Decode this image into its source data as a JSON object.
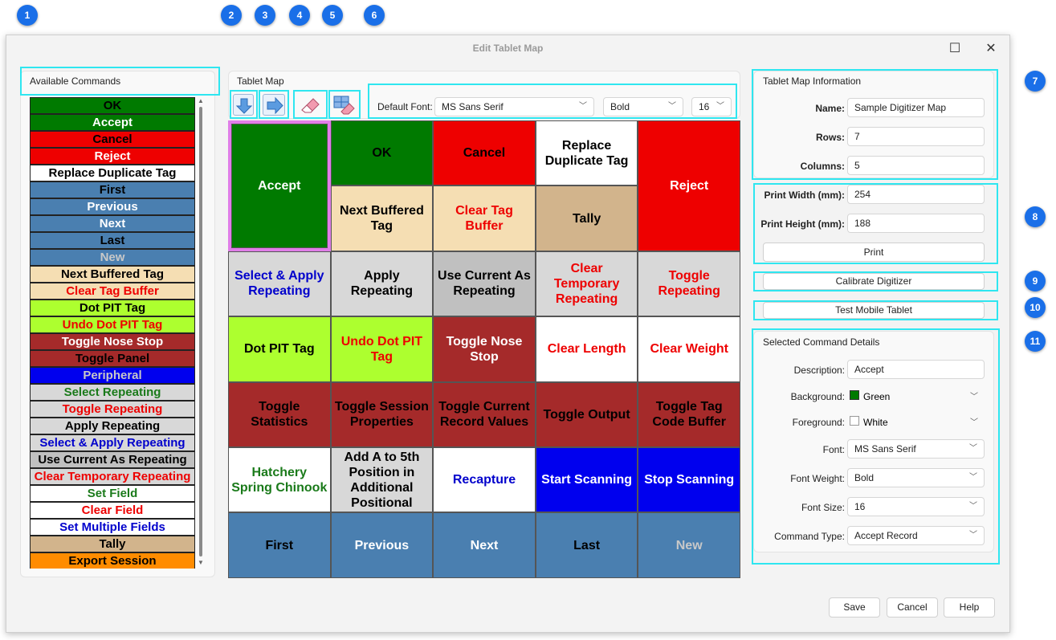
{
  "window": {
    "title": "Edit Tablet Map",
    "maximize_glyph": "☐",
    "close_glyph": "✕"
  },
  "callouts": [
    "1",
    "2",
    "3",
    "4",
    "5",
    "6",
    "7",
    "8",
    "9",
    "10",
    "11"
  ],
  "available": {
    "caption": "Available Commands",
    "items": [
      {
        "label": "OK",
        "bg": "#007a00",
        "fg": "#000000"
      },
      {
        "label": "Accept",
        "bg": "#007a00",
        "fg": "#ffffff"
      },
      {
        "label": "Cancel",
        "bg": "#ee0000",
        "fg": "#000000"
      },
      {
        "label": "Reject",
        "bg": "#ee0000",
        "fg": "#ffffff"
      },
      {
        "label": "Replace Duplicate Tag",
        "bg": "#ffffff",
        "fg": "#000000"
      },
      {
        "label": "First",
        "bg": "#4a7fb0",
        "fg": "#000000"
      },
      {
        "label": "Previous",
        "bg": "#4a7fb0",
        "fg": "#ffffff"
      },
      {
        "label": "Next",
        "bg": "#4a7fb0",
        "fg": "#ffffff"
      },
      {
        "label": "Last",
        "bg": "#4a7fb0",
        "fg": "#000000"
      },
      {
        "label": "New",
        "bg": "#4a7fb0",
        "fg": "#c8c8c8"
      },
      {
        "label": "Next Buffered Tag",
        "bg": "#f5deb3",
        "fg": "#000000"
      },
      {
        "label": "Clear Tag Buffer",
        "bg": "#f5deb3",
        "fg": "#ee0000"
      },
      {
        "label": "Dot PIT Tag",
        "bg": "#adff2f",
        "fg": "#000000"
      },
      {
        "label": "Undo Dot PIT Tag",
        "bg": "#adff2f",
        "fg": "#ee0000"
      },
      {
        "label": "Toggle Nose Stop",
        "bg": "#a52a2a",
        "fg": "#ffffff"
      },
      {
        "label": "Toggle Panel",
        "bg": "#a52a2a",
        "fg": "#000000"
      },
      {
        "label": "Peripheral",
        "bg": "#0000ee",
        "fg": "#c8c8c8"
      },
      {
        "label": "Select Repeating",
        "bg": "#d8d8d8",
        "fg": "#1a7a1a"
      },
      {
        "label": "Toggle Repeating",
        "bg": "#d8d8d8",
        "fg": "#ee0000"
      },
      {
        "label": "Apply Repeating",
        "bg": "#d8d8d8",
        "fg": "#000000"
      },
      {
        "label": "Select & Apply Repeating",
        "bg": "#d8d8d8",
        "fg": "#0000cc"
      },
      {
        "label": "Use Current As Repeating",
        "bg": "#c0c0c0",
        "fg": "#000000"
      },
      {
        "label": "Clear Temporary Repeating",
        "bg": "#d8d8d8",
        "fg": "#ee0000"
      },
      {
        "label": "Set Field",
        "bg": "#ffffff",
        "fg": "#1a7a1a"
      },
      {
        "label": "Clear Field",
        "bg": "#ffffff",
        "fg": "#ee0000"
      },
      {
        "label": "Set Multiple Fields",
        "bg": "#ffffff",
        "fg": "#0000cc"
      },
      {
        "label": "Tally",
        "bg": "#d2b48c",
        "fg": "#000000"
      },
      {
        "label": "Export Session",
        "bg": "#ff8c00",
        "fg": "#000000"
      }
    ]
  },
  "tablet_map": {
    "caption": "Tablet Map",
    "default_font_label": "Default Font:",
    "font": "MS Sans Serif",
    "weight": "Bold",
    "size": "16",
    "cells": [
      {
        "label": "Accept",
        "bg": "#007a00",
        "fg": "#ffffff",
        "selected": true
      },
      {
        "label": "OK",
        "bg": "#007a00",
        "fg": "#000000"
      },
      {
        "label": "Cancel",
        "bg": "#ee0000",
        "fg": "#000000"
      },
      {
        "label": "Replace Duplicate Tag",
        "bg": "#ffffff",
        "fg": "#000000"
      },
      {
        "label": "Reject",
        "bg": "#ee0000",
        "fg": "#ffffff"
      },
      {
        "label": "Next Buffered Tag",
        "bg": "#f5deb3",
        "fg": "#000000"
      },
      {
        "label": "Clear Tag Buffer",
        "bg": "#f5deb3",
        "fg": "#ee0000"
      },
      {
        "label": "Tally",
        "bg": "#d2b48c",
        "fg": "#000000"
      },
      {
        "label": "Select & Apply Repeating",
        "bg": "#d8d8d8",
        "fg": "#0000cc"
      },
      {
        "label": "Apply Repeating",
        "bg": "#d8d8d8",
        "fg": "#000000"
      },
      {
        "label": "Use Current As Repeating",
        "bg": "#c0c0c0",
        "fg": "#000000"
      },
      {
        "label": "Clear Temporary Repeating",
        "bg": "#d8d8d8",
        "fg": "#ee0000"
      },
      {
        "label": "Toggle Repeating",
        "bg": "#d8d8d8",
        "fg": "#ee0000"
      },
      {
        "label": "Dot PIT Tag",
        "bg": "#adff2f",
        "fg": "#000000"
      },
      {
        "label": "Undo Dot PIT Tag",
        "bg": "#adff2f",
        "fg": "#ee0000"
      },
      {
        "label": "Toggle Nose Stop",
        "bg": "#a52a2a",
        "fg": "#ffffff"
      },
      {
        "label": "Clear Length",
        "bg": "#ffffff",
        "fg": "#ee0000"
      },
      {
        "label": "Clear Weight",
        "bg": "#ffffff",
        "fg": "#ee0000"
      },
      {
        "label": "Toggle Statistics",
        "bg": "#a52a2a",
        "fg": "#000000"
      },
      {
        "label": "Toggle Session Properties",
        "bg": "#a52a2a",
        "fg": "#000000"
      },
      {
        "label": "Toggle Current Record Values",
        "bg": "#a52a2a",
        "fg": "#000000"
      },
      {
        "label": "Toggle Output",
        "bg": "#a52a2a",
        "fg": "#000000"
      },
      {
        "label": "Toggle Tag Code Buffer",
        "bg": "#a52a2a",
        "fg": "#000000"
      },
      {
        "label": "Hatchery Spring Chinook",
        "bg": "#ffffff",
        "fg": "#1a7a1a"
      },
      {
        "label": "Add A to 5th Position in Additional Positional",
        "bg": "#d8d8d8",
        "fg": "#000000"
      },
      {
        "label": "Recapture",
        "bg": "#ffffff",
        "fg": "#0000cc"
      },
      {
        "label": "Start Scanning",
        "bg": "#0000ee",
        "fg": "#ffffff"
      },
      {
        "label": "Stop Scanning",
        "bg": "#0000ee",
        "fg": "#ffffff"
      },
      {
        "label": "First",
        "bg": "#4a7fb0",
        "fg": "#000000"
      },
      {
        "label": "Previous",
        "bg": "#4a7fb0",
        "fg": "#ffffff"
      },
      {
        "label": "Next",
        "bg": "#4a7fb0",
        "fg": "#ffffff"
      },
      {
        "label": "Last",
        "bg": "#4a7fb0",
        "fg": "#000000"
      },
      {
        "label": "New",
        "bg": "#4a7fb0",
        "fg": "#c8c8c8"
      }
    ]
  },
  "info": {
    "caption": "Tablet Map Information",
    "name_label": "Name:",
    "name": "Sample Digitizer Map",
    "rows_label": "Rows:",
    "rows": "7",
    "cols_label": "Columns:",
    "cols": "5"
  },
  "print": {
    "width_label": "Print Width (mm):",
    "width": "254",
    "height_label": "Print Height (mm):",
    "height": "188",
    "button": "Print"
  },
  "calibrate_button": "Calibrate Digitizer",
  "test_button": "Test Mobile Tablet",
  "details": {
    "caption": "Selected Command Details",
    "description_label": "Description:",
    "description": "Accept",
    "background_label": "Background:",
    "background": "Green",
    "background_color": "#007a00",
    "foreground_label": "Foreground:",
    "foreground": "White",
    "foreground_color": "#ffffff",
    "font_label": "Font:",
    "font": "MS Sans Serif",
    "weight_label": "Font Weight:",
    "weight": "Bold",
    "size_label": "Font Size:",
    "size": "16",
    "type_label": "Command Type:",
    "type": "Accept Record"
  },
  "footer": {
    "save": "Save",
    "cancel": "Cancel",
    "help": "Help"
  }
}
